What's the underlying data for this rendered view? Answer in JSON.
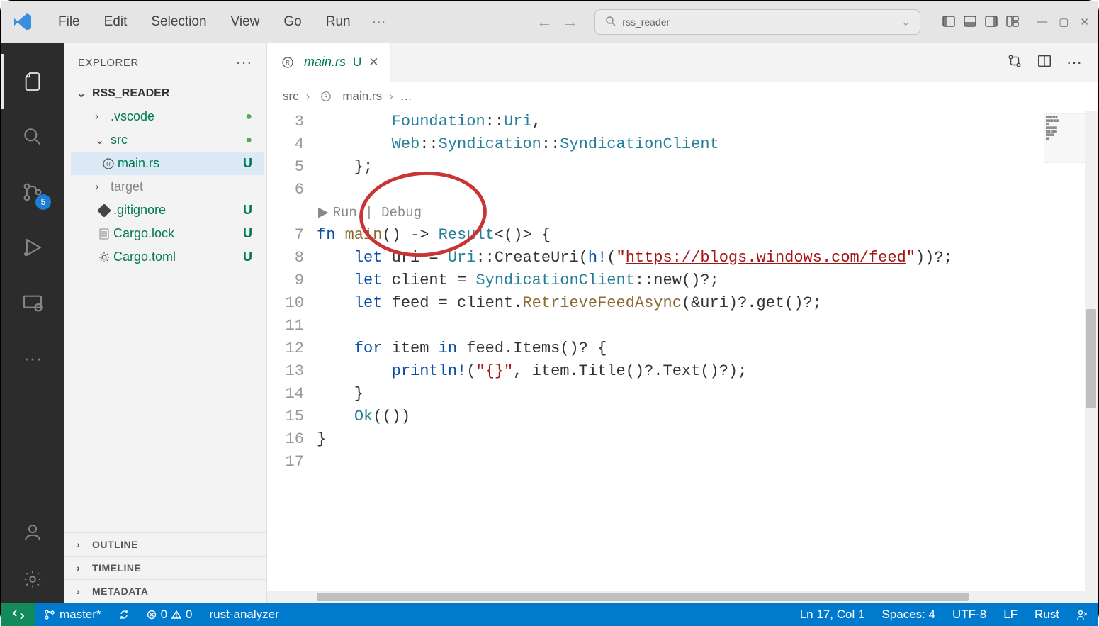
{
  "menu": {
    "file": "File",
    "edit": "Edit",
    "selection": "Selection",
    "view": "View",
    "go": "Go",
    "run": "Run"
  },
  "search_placeholder": "rss_reader",
  "sidebar": {
    "title": "EXPLORER",
    "root": "RSS_READER",
    "items": [
      {
        "label": ".vscode",
        "status": "dot"
      },
      {
        "label": "src",
        "status": "dot"
      },
      {
        "label": "main.rs",
        "status": "U"
      },
      {
        "label": "target",
        "status": ""
      },
      {
        "label": ".gitignore",
        "status": "U"
      },
      {
        "label": "Cargo.lock",
        "status": "U"
      },
      {
        "label": "Cargo.toml",
        "status": "U"
      }
    ],
    "outline": "OUTLINE",
    "timeline": "TIMELINE",
    "metadata": "METADATA"
  },
  "scm_badge": "5",
  "tab": {
    "name": "main.rs",
    "status": "U"
  },
  "breadcrumb": {
    "src": "src",
    "file": "main.rs",
    "ellipsis": "…"
  },
  "codelens": {
    "run": "Run",
    "debug": "Debug"
  },
  "line_numbers": [
    "3",
    "4",
    "5",
    "6",
    "",
    "7",
    "8",
    "9",
    "10",
    "11",
    "12",
    "13",
    "14",
    "15",
    "16",
    "17"
  ],
  "code": {
    "l3_indent": "        ",
    "l3_a": "Foundation",
    "l3_b": "::",
    "l3_c": "Uri",
    "l3_d": ",",
    "l4_indent": "        ",
    "l4_a": "Web",
    "l4_b": "::",
    "l4_c": "Syndication",
    "l4_d": "::",
    "l4_e": "SyndicationClient",
    "l5": "    };",
    "l7_fn": "fn",
    "l7_name": " main",
    "l7_paren": "() ",
    "l7_arrow": "-> ",
    "l7_result": "Result",
    "l7_gen": "<()> {",
    "l8_indent": "    ",
    "l8_let": "let",
    "l8_var": " uri ",
    "l8_eq": "= ",
    "l8_uri": "Uri",
    "l8_call": "::CreateUri(",
    "l8_h": "h!",
    "l8_open": "(",
    "l8_str": "\"",
    "l8_url": "https://blogs.windows.com/feed",
    "l8_strend": "\"",
    "l8_close": "))?;",
    "l9_indent": "    ",
    "l9_let": "let",
    "l9_var": " client ",
    "l9_eq": "= ",
    "l9_type": "SyndicationClient",
    "l9_rest": "::new()?;",
    "l10_indent": "    ",
    "l10_let": "let",
    "l10_var": " feed ",
    "l10_eq": "= client.",
    "l10_call": "RetrieveFeedAsync",
    "l10_rest": "(&uri)?.get()?;",
    "l12_indent": "    ",
    "l12_for": "for",
    "l12_item": " item ",
    "l12_in": "in",
    "l12_rest": " feed.Items()? {",
    "l13_indent": "        ",
    "l13_pr": "println!",
    "l13_open": "(",
    "l13_str": "\"{}\"",
    "l13_rest": ", item.Title()?.Text()?);",
    "l14": "    }",
    "l15_indent": "    ",
    "l15_ok": "Ok",
    "l15_rest": "(())",
    "l16": "}"
  },
  "statusbar": {
    "branch": "master*",
    "errors": "0",
    "warnings": "0",
    "lsp": "rust-analyzer",
    "position": "Ln 17, Col 1",
    "spaces": "Spaces: 4",
    "encoding": "UTF-8",
    "eol": "LF",
    "lang": "Rust"
  }
}
